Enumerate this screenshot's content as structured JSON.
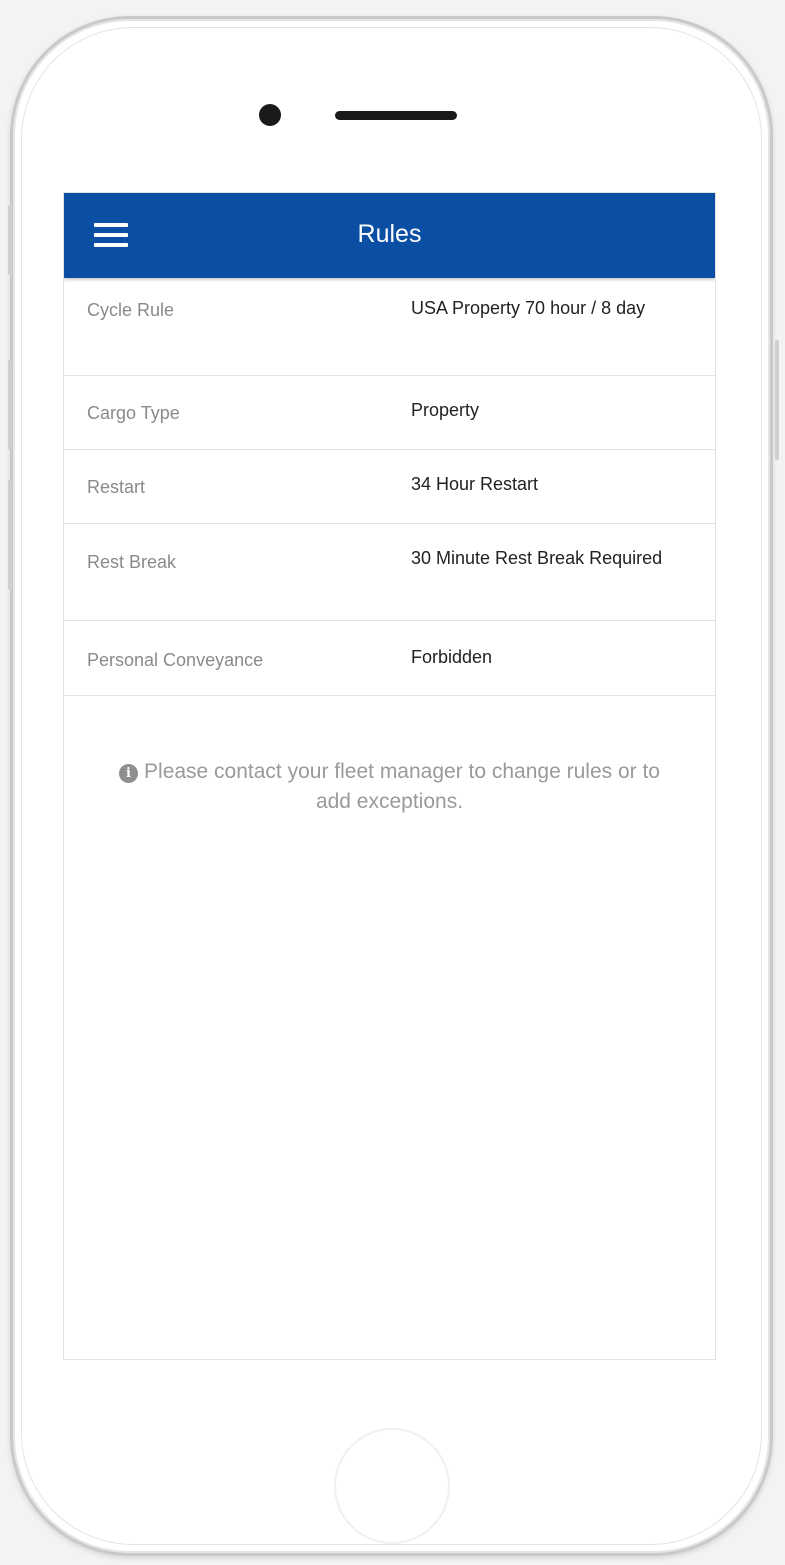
{
  "appbar": {
    "title": "Rules",
    "menu_icon": "hamburger-menu-icon"
  },
  "rules": [
    {
      "label": "Cycle Rule",
      "value": "USA Property 70 hour / 8 day"
    },
    {
      "label": "Cargo Type",
      "value": "Property"
    },
    {
      "label": "Restart",
      "value": "34 Hour Restart"
    },
    {
      "label": "Rest Break",
      "value": "30 Minute Rest Break Required"
    },
    {
      "label": "Personal Conveyance",
      "value": "Forbidden"
    }
  ],
  "notice": {
    "icon": "info-icon",
    "icon_glyph": "i",
    "text": "Please contact your fleet manager to change rules or to add exceptions."
  },
  "colors": {
    "appbar": "#0a4fa3",
    "label": "#8a8a8a",
    "value": "#222222",
    "notice": "#9a9a9a"
  }
}
